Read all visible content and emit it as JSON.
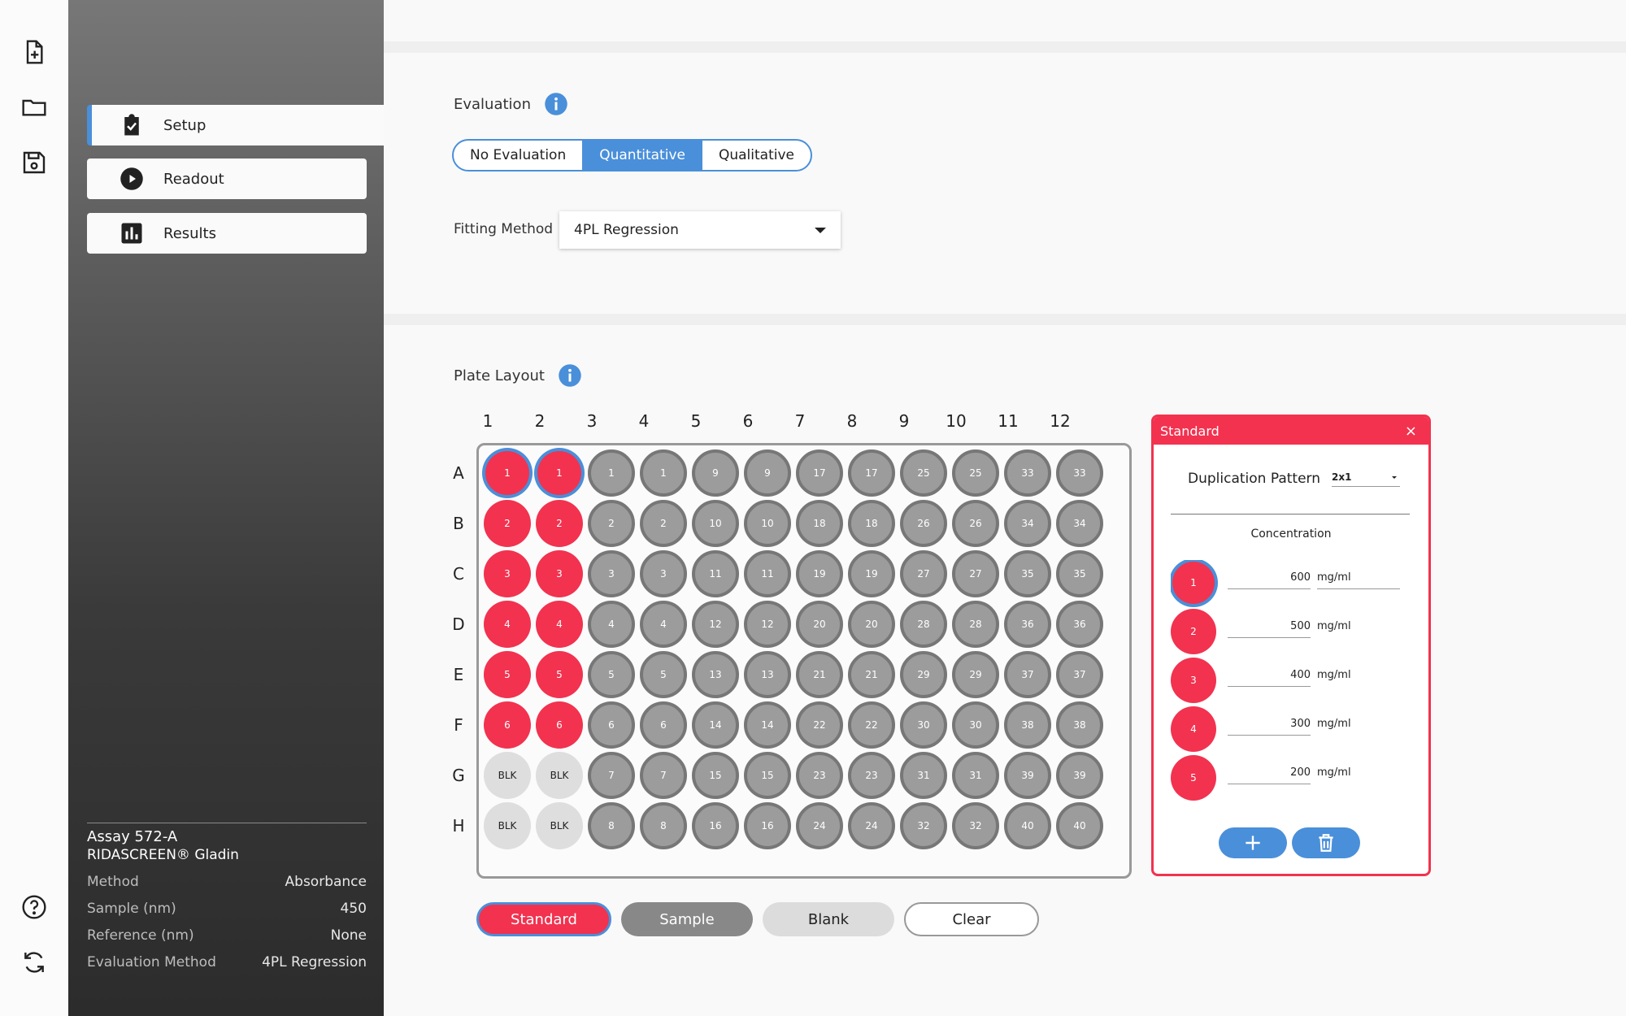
{
  "rail": {
    "top_icons": [
      "new-file-icon",
      "folder-icon",
      "save-icon"
    ],
    "bottom_icons": [
      "help-icon",
      "sync-icon"
    ]
  },
  "sidebar": {
    "nav": [
      {
        "label": "Setup",
        "icon": "clipboard-check-icon",
        "active": true
      },
      {
        "label": "Readout",
        "icon": "play-circle-icon",
        "active": false
      },
      {
        "label": "Results",
        "icon": "bar-chart-icon",
        "active": false
      }
    ],
    "assay": {
      "id": "Assay 572-A",
      "kit": "RIDASCREEN® Gladin",
      "rows": [
        {
          "label": "Method",
          "value": "Absorbance"
        },
        {
          "label": "Sample (nm)",
          "value": "450"
        },
        {
          "label": "Reference (nm)",
          "value": "None"
        },
        {
          "label": "Evaluation Method",
          "value": "4PL Regression"
        }
      ]
    }
  },
  "evaluation": {
    "title": "Evaluation",
    "options": [
      "No Evaluation",
      "Quantitative",
      "Qualitative"
    ],
    "selected": "Quantitative",
    "fitting_label": "Fitting Method",
    "fitting_value": "4PL Regression"
  },
  "plate": {
    "title": "Plate Layout",
    "columns": [
      "1",
      "2",
      "3",
      "4",
      "5",
      "6",
      "7",
      "8",
      "9",
      "10",
      "11",
      "12"
    ],
    "rows": [
      "A",
      "B",
      "C",
      "D",
      "E",
      "F",
      "G",
      "H"
    ],
    "wells": [
      [
        {
          "t": "std",
          "l": "1",
          "sel": true
        },
        {
          "t": "std",
          "l": "1",
          "sel": true
        },
        {
          "t": "smp",
          "l": "1"
        },
        {
          "t": "smp",
          "l": "1"
        },
        {
          "t": "smp",
          "l": "9"
        },
        {
          "t": "smp",
          "l": "9"
        },
        {
          "t": "smp",
          "l": "17"
        },
        {
          "t": "smp",
          "l": "17"
        },
        {
          "t": "smp",
          "l": "25"
        },
        {
          "t": "smp",
          "l": "25"
        },
        {
          "t": "smp",
          "l": "33"
        },
        {
          "t": "smp",
          "l": "33"
        }
      ],
      [
        {
          "t": "std",
          "l": "2"
        },
        {
          "t": "std",
          "l": "2"
        },
        {
          "t": "smp",
          "l": "2"
        },
        {
          "t": "smp",
          "l": "2"
        },
        {
          "t": "smp",
          "l": "10"
        },
        {
          "t": "smp",
          "l": "10"
        },
        {
          "t": "smp",
          "l": "18"
        },
        {
          "t": "smp",
          "l": "18"
        },
        {
          "t": "smp",
          "l": "26"
        },
        {
          "t": "smp",
          "l": "26"
        },
        {
          "t": "smp",
          "l": "34"
        },
        {
          "t": "smp",
          "l": "34"
        }
      ],
      [
        {
          "t": "std",
          "l": "3"
        },
        {
          "t": "std",
          "l": "3"
        },
        {
          "t": "smp",
          "l": "3"
        },
        {
          "t": "smp",
          "l": "3"
        },
        {
          "t": "smp",
          "l": "11"
        },
        {
          "t": "smp",
          "l": "11"
        },
        {
          "t": "smp",
          "l": "19"
        },
        {
          "t": "smp",
          "l": "19"
        },
        {
          "t": "smp",
          "l": "27"
        },
        {
          "t": "smp",
          "l": "27"
        },
        {
          "t": "smp",
          "l": "35"
        },
        {
          "t": "smp",
          "l": "35"
        }
      ],
      [
        {
          "t": "std",
          "l": "4"
        },
        {
          "t": "std",
          "l": "4"
        },
        {
          "t": "smp",
          "l": "4"
        },
        {
          "t": "smp",
          "l": "4"
        },
        {
          "t": "smp",
          "l": "12"
        },
        {
          "t": "smp",
          "l": "12"
        },
        {
          "t": "smp",
          "l": "20"
        },
        {
          "t": "smp",
          "l": "20"
        },
        {
          "t": "smp",
          "l": "28"
        },
        {
          "t": "smp",
          "l": "28"
        },
        {
          "t": "smp",
          "l": "36"
        },
        {
          "t": "smp",
          "l": "36"
        }
      ],
      [
        {
          "t": "std",
          "l": "5"
        },
        {
          "t": "std",
          "l": "5"
        },
        {
          "t": "smp",
          "l": "5"
        },
        {
          "t": "smp",
          "l": "5"
        },
        {
          "t": "smp",
          "l": "13"
        },
        {
          "t": "smp",
          "l": "13"
        },
        {
          "t": "smp",
          "l": "21"
        },
        {
          "t": "smp",
          "l": "21"
        },
        {
          "t": "smp",
          "l": "29"
        },
        {
          "t": "smp",
          "l": "29"
        },
        {
          "t": "smp",
          "l": "37"
        },
        {
          "t": "smp",
          "l": "37"
        }
      ],
      [
        {
          "t": "std",
          "l": "6"
        },
        {
          "t": "std",
          "l": "6"
        },
        {
          "t": "smp",
          "l": "6"
        },
        {
          "t": "smp",
          "l": "6"
        },
        {
          "t": "smp",
          "l": "14"
        },
        {
          "t": "smp",
          "l": "14"
        },
        {
          "t": "smp",
          "l": "22"
        },
        {
          "t": "smp",
          "l": "22"
        },
        {
          "t": "smp",
          "l": "30"
        },
        {
          "t": "smp",
          "l": "30"
        },
        {
          "t": "smp",
          "l": "38"
        },
        {
          "t": "smp",
          "l": "38"
        }
      ],
      [
        {
          "t": "blk",
          "l": "BLK"
        },
        {
          "t": "blk",
          "l": "BLK"
        },
        {
          "t": "smp",
          "l": "7"
        },
        {
          "t": "smp",
          "l": "7"
        },
        {
          "t": "smp",
          "l": "15"
        },
        {
          "t": "smp",
          "l": "15"
        },
        {
          "t": "smp",
          "l": "23"
        },
        {
          "t": "smp",
          "l": "23"
        },
        {
          "t": "smp",
          "l": "31"
        },
        {
          "t": "smp",
          "l": "31"
        },
        {
          "t": "smp",
          "l": "39"
        },
        {
          "t": "smp",
          "l": "39"
        }
      ],
      [
        {
          "t": "blk",
          "l": "BLK"
        },
        {
          "t": "blk",
          "l": "BLK"
        },
        {
          "t": "smp",
          "l": "8"
        },
        {
          "t": "smp",
          "l": "8"
        },
        {
          "t": "smp",
          "l": "16"
        },
        {
          "t": "smp",
          "l": "16"
        },
        {
          "t": "smp",
          "l": "24"
        },
        {
          "t": "smp",
          "l": "24"
        },
        {
          "t": "smp",
          "l": "32"
        },
        {
          "t": "smp",
          "l": "32"
        },
        {
          "t": "smp",
          "l": "40"
        },
        {
          "t": "smp",
          "l": "40"
        }
      ]
    ],
    "type_buttons": [
      "Standard",
      "Sample",
      "Blank",
      "Clear"
    ]
  },
  "standard_panel": {
    "title": "Standard",
    "close_label": "×",
    "duplication_label": "Duplication Pattern",
    "duplication_value": "2x1",
    "concentration_title": "Concentration",
    "items": [
      {
        "well": "1",
        "value": "600",
        "unit": "mg/ml",
        "selected": true
      },
      {
        "well": "2",
        "value": "500",
        "unit": "mg/ml"
      },
      {
        "well": "3",
        "value": "400",
        "unit": "mg/ml"
      },
      {
        "well": "4",
        "value": "300",
        "unit": "mg/ml"
      },
      {
        "well": "5",
        "value": "200",
        "unit": "mg/ml"
      }
    ],
    "actions": [
      "add-icon",
      "trash-icon"
    ]
  },
  "colors": {
    "accent": "#4a8fd9",
    "standard": "#f2324f",
    "sample": "#9c9c9c",
    "blank": "#dedede"
  }
}
